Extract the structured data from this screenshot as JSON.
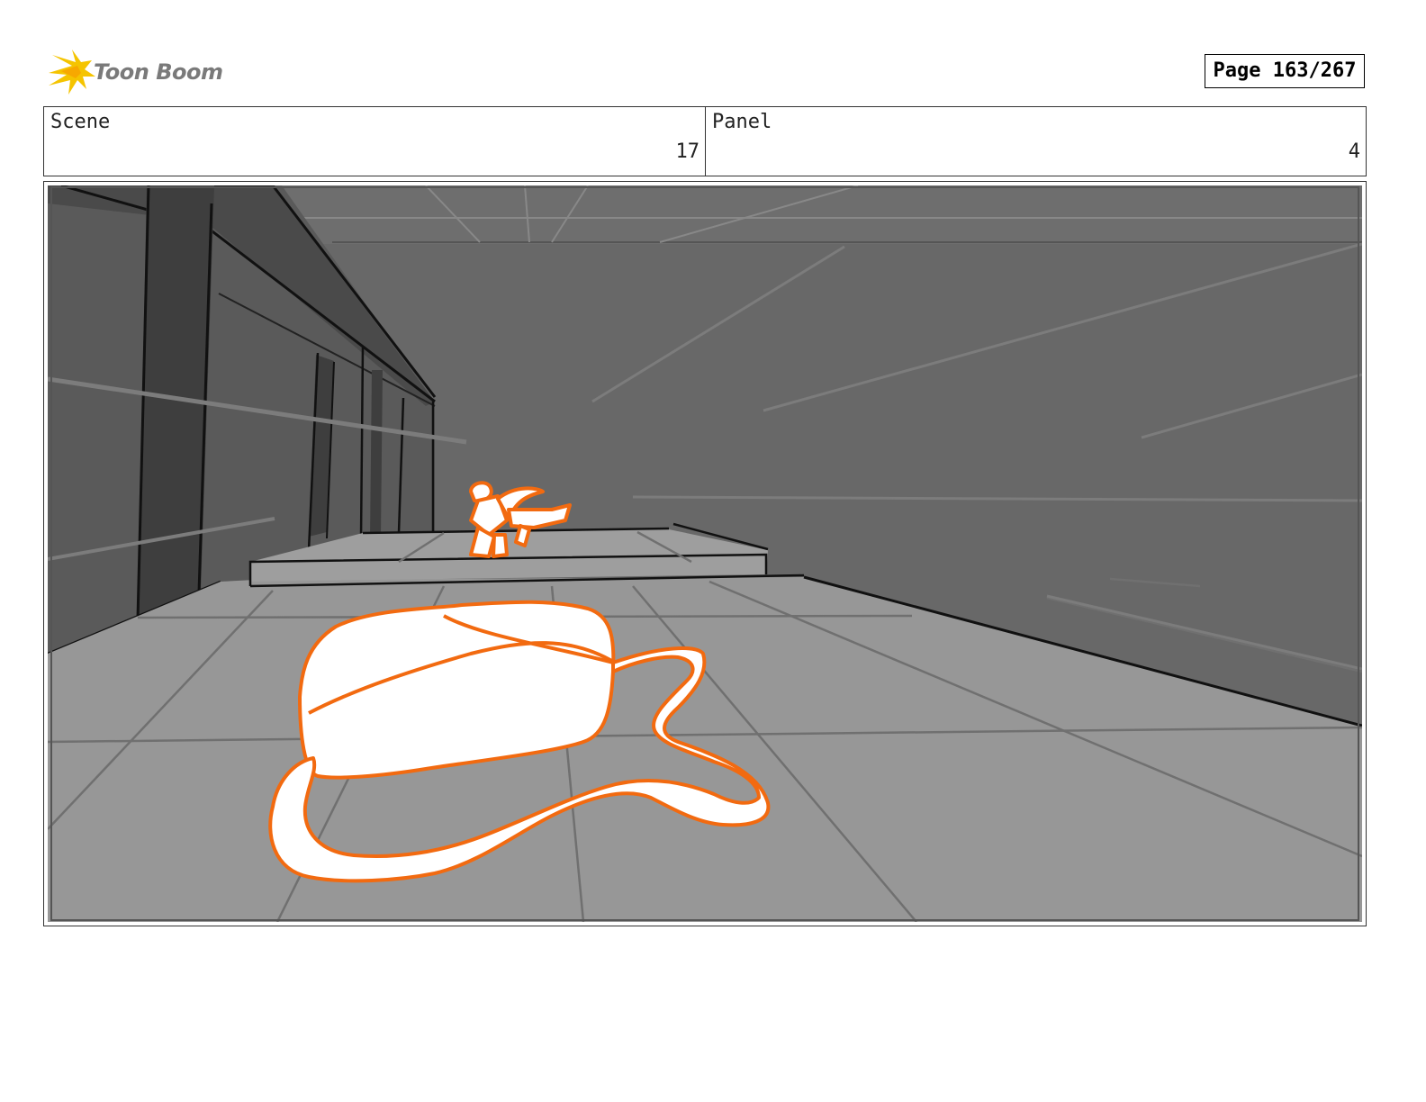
{
  "header": {
    "logo_text": "Toon Boom",
    "page_label": "Page 163/267"
  },
  "info": {
    "scene_label": "Scene",
    "scene_value": "17",
    "panel_label": "Panel",
    "panel_value": "4"
  },
  "colors": {
    "logo_accent": "#f5c400",
    "sketch_orange": "#f26a10"
  }
}
